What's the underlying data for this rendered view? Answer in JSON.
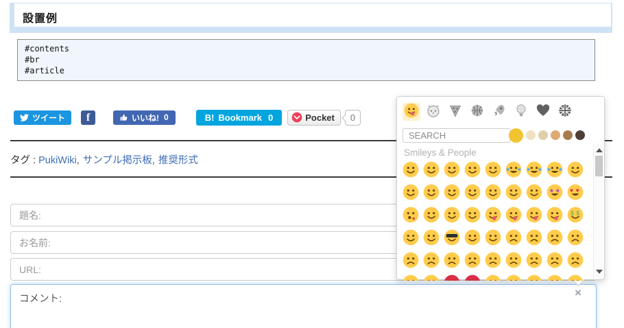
{
  "colors": {
    "twitter_blue": "#1B95E0",
    "facebook_blue": "#3E5B98",
    "like_blue": "#4267B2",
    "hatena_blue": "#00A5DE",
    "pocket_red": "#EF4056",
    "link_blue": "#3F6EB5",
    "emoji_yellow": "#FFCC4D",
    "emoji_red": "#DA2F47",
    "heading_accent": "#CFE2F5",
    "code_bg": "#F0F6FC"
  },
  "heading": {
    "title": "設置例"
  },
  "code_block": {
    "lines": [
      "#contents",
      "#br",
      "#article"
    ]
  },
  "share": {
    "tweet_label": "ツイート",
    "facebook_label": "f",
    "like_label": "いいね!",
    "like_count": "0",
    "hatena_b": "B!",
    "hatena_label": "Bookmark",
    "hatena_count": "0",
    "pocket_label": "Pocket",
    "pocket_count": "0"
  },
  "tags": {
    "label": "タグ :",
    "separator": ",",
    "items": [
      "PukiWiki",
      "サンプル掲示板",
      "推奨形式"
    ]
  },
  "form": {
    "subject_placeholder": "題名:",
    "name_placeholder": "お名前:",
    "url_placeholder": "URL:",
    "comment_placeholder": "コメント:",
    "close_icon": "×"
  },
  "emoji_panel": {
    "search_placeholder": "SEARCH",
    "category_title": "Smileys & People",
    "tabs": [
      {
        "icon": "face-savoring-food-icon",
        "char": "😋",
        "active": true
      },
      {
        "icon": "hamster-icon",
        "char": "🐹",
        "active": false
      },
      {
        "icon": "pizza-icon",
        "char": "🍕",
        "active": false
      },
      {
        "icon": "basketball-icon",
        "char": "🏀",
        "active": false
      },
      {
        "icon": "rocket-icon",
        "char": "🚀",
        "active": false
      },
      {
        "icon": "light-bulb-icon",
        "char": "💡",
        "active": false
      },
      {
        "icon": "heart-icon",
        "char": "❤",
        "active": false
      },
      {
        "icon": "flag-icon",
        "char": "🎌",
        "active": false
      }
    ],
    "skin_tones": [
      {
        "color": "#F2C431",
        "selected": true
      },
      {
        "color": "#F2E0C4",
        "selected": false
      },
      {
        "color": "#DFD0A9",
        "selected": false
      },
      {
        "color": "#DFA971",
        "selected": false
      },
      {
        "color": "#A87B4F",
        "selected": false
      },
      {
        "color": "#4F3E35",
        "selected": false
      }
    ],
    "grid_rows": [
      [
        "😀",
        "😃",
        "😄",
        "😁",
        "😆",
        "😅",
        "😂",
        "🤣",
        "☺️"
      ],
      [
        "😊",
        "😇",
        "🙂",
        "🙃",
        "😉",
        "😌",
        "😳",
        "🤩",
        "😍"
      ],
      [
        "😘",
        "😗",
        "😙",
        "😚",
        "😋",
        "😜",
        "😝",
        "😛",
        "🤑"
      ],
      [
        "🤗",
        "🤓",
        "😎",
        "🤠",
        "😏",
        "😒",
        "😞",
        "😔",
        "😟"
      ],
      [
        "🤨",
        "🧐",
        "😕",
        "🙁",
        "☹️",
        "😣",
        "😖",
        "😫",
        "😩"
      ],
      [
        "😭",
        "😤",
        "😠",
        "😡",
        "😶",
        "😐",
        "😑",
        "😯",
        "😮"
      ]
    ],
    "red_faces": [
      "😠",
      "😡",
      "🤬"
    ]
  }
}
